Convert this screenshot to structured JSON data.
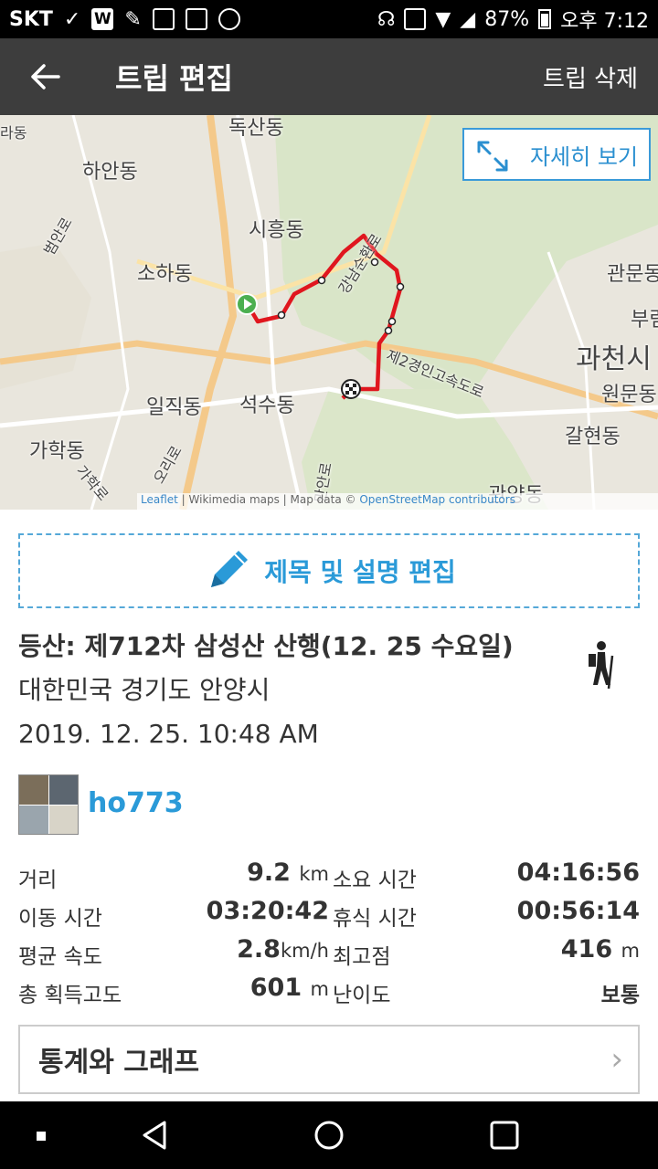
{
  "status_bar": {
    "carrier": "SKT",
    "battery": "87%",
    "time": "오후 7:12",
    "w_icon": "W"
  },
  "app_bar": {
    "title": "트립 편집",
    "action": "트립 삭제",
    "back_icon": "arrow-left-icon"
  },
  "map": {
    "detail_button": "자세히 보기",
    "labels": [
      "독산동",
      "하안동",
      "시흥동",
      "소하동",
      "일직동",
      "석수동",
      "가학동",
      "관문동",
      "과천시",
      "원문동",
      "갈현동",
      "관양동",
      "강남순환로",
      "제2경인고속도로",
      "부림",
      "라동",
      "오리로",
      "범안로",
      "가학로",
      "만안로"
    ],
    "attribution": {
      "leaflet": "Leaflet",
      "text": " | Wikimedia maps | Map data © ",
      "osm": "OpenStreetMap contributors"
    },
    "route_color": "#e0161e"
  },
  "edit_button": {
    "label": "제목 및 설명 편집",
    "icon": "pencil-icon"
  },
  "trip": {
    "title": "등산: 제712차 삼성산 산행(12. 25 수요일)",
    "location": "대한민국 경기도 안양시",
    "datetime": "2019. 12. 25. 10:48 AM",
    "activity_icon": "hiker-icon"
  },
  "user": {
    "name": "ho773"
  },
  "stats": [
    {
      "label": "거리",
      "value": "9.2",
      "unit": "km",
      "label2": "소요 시간",
      "value2": "04:16:56",
      "unit2": ""
    },
    {
      "label": "이동 시간",
      "value": "03:20:42",
      "unit": "",
      "label2": "휴식 시간",
      "value2": "00:56:14",
      "unit2": ""
    },
    {
      "label": "평균 속도",
      "value": "2.8",
      "unit": "km/h",
      "label2": "최고점",
      "value2": "416",
      "unit2": "m"
    },
    {
      "label": "총 획득고도",
      "value": "601",
      "unit": "m",
      "label2": "난이도",
      "value2": "보통",
      "unit2": ""
    }
  ],
  "graph_button": {
    "label": "통계와 그래프",
    "chevron": "›"
  }
}
